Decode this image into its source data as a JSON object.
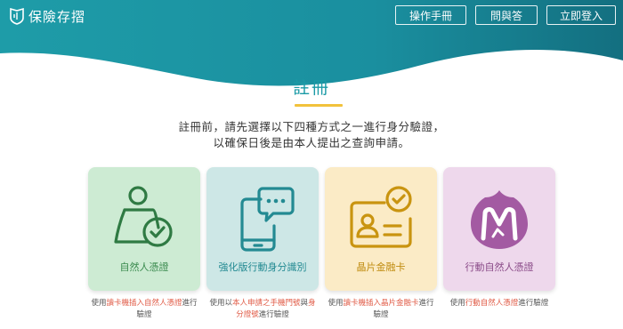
{
  "header": {
    "app_name": "保險存摺",
    "nav": {
      "manual": "操作手冊",
      "faq": "問與答",
      "login": "立即登入"
    }
  },
  "main": {
    "title": "註冊",
    "intro_line1": "註冊前，請先選擇以下四種方式之一進行身分驗證，",
    "intro_line2": "以確保日後是由本人提出之查詢申請。",
    "cards": [
      {
        "label": "自然人憑證",
        "icon": "person-check-icon",
        "note_pre": "使用",
        "note_hl": "讀卡機插入自然人憑證",
        "note_post1": "進行",
        "note_post2": "驗證"
      },
      {
        "label": "強化版行動身分識別",
        "icon": "phone-chat-icon",
        "note_pre": "使用以",
        "note_hl1": "本人申請之手機門號",
        "note_mid": "與",
        "note_hl2a": "身",
        "note_hl2b": "分證號",
        "note_post": "進行驗證"
      },
      {
        "label": "晶片金融卡",
        "icon": "id-card-check-icon",
        "note_pre": "使用",
        "note_hl": "讀卡機插入晶片金融卡",
        "note_post1": "進行",
        "note_post2": "驗證"
      },
      {
        "label": "行動自然人憑證",
        "icon": "mobile-cert-logo-icon",
        "note_pre": "使用",
        "note_hl": "行動自然人憑證",
        "note_post": "進行驗證"
      }
    ]
  },
  "colors": {
    "header_teal": "#1e9ca8",
    "header_dark": "#136f80",
    "accent_yellow": "#f2c23c",
    "card1": "#cdebd3",
    "card2": "#cde7e6",
    "card3": "#fbebc6",
    "card4": "#eed8ec",
    "highlight": "#e05a45"
  }
}
